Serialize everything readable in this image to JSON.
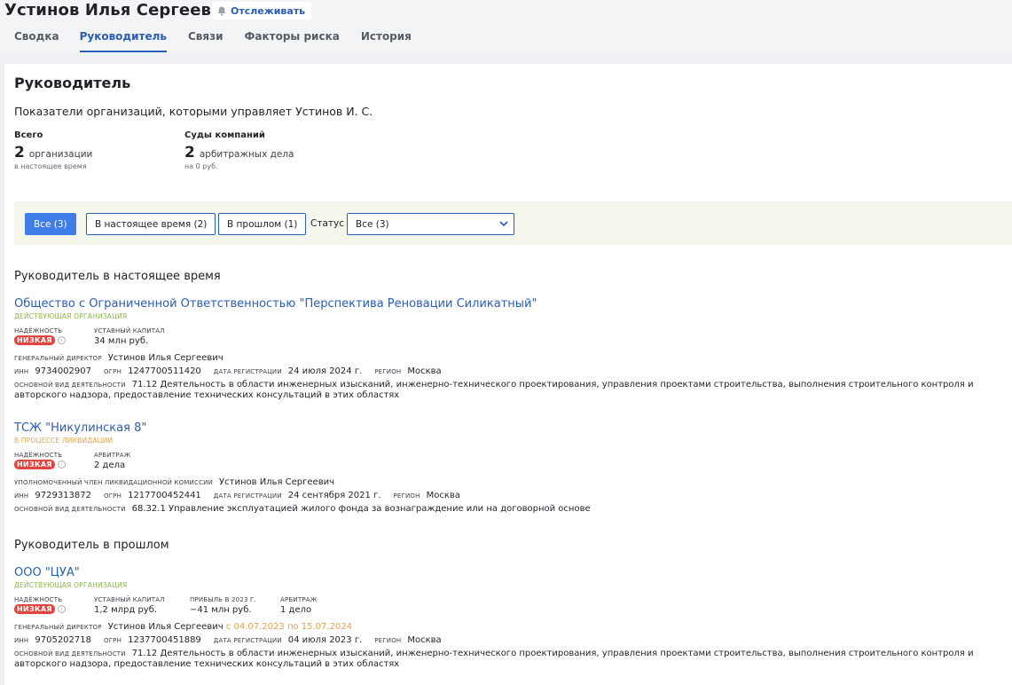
{
  "header": {
    "person_name": "Устинов Илья Сергеевич",
    "track_label": "Отслеживать",
    "tabs": [
      {
        "label": "Сводка"
      },
      {
        "label": "Руководитель"
      },
      {
        "label": "Связи"
      },
      {
        "label": "Факторы риска"
      },
      {
        "label": "История"
      }
    ]
  },
  "section": {
    "title": "Руководитель",
    "subtitle": "Показатели организаций, которыми управляет Устинов И. С.",
    "stats": [
      {
        "label": "Всего",
        "value": "2",
        "unit": "организации",
        "note": "в настоящее время"
      },
      {
        "label": "Суды компаний",
        "value": "2",
        "unit": "арбитражных дела",
        "note": "на 0 руб."
      }
    ]
  },
  "filters": {
    "all": "Все (3)",
    "current": "В настоящее время (2)",
    "past": "В прошлом (1)",
    "status_label": "Статус",
    "status_value": "Все (3)"
  },
  "groups": {
    "current_title": "Руководитель в настоящее время",
    "past_title": "Руководитель в прошлом"
  },
  "orgs": [
    {
      "name": "Общество с Ограниченной Ответственностью \"Перспектива Реновации Силикатный\"",
      "status": "ДЕЙСТВУЮЩАЯ ОРГАНИЗАЦИЯ",
      "reliability_label": "НАДЁЖНОСТЬ",
      "reliability": "НИЗКАЯ",
      "m2_label": "УСТАВНЫЙ КАПИТАЛ",
      "m2_value": "34 млн руб.",
      "role_label": "ГЕНЕРАЛЬНЫЙ ДИРЕКТОР",
      "role_value": "Устинов Илья Сергеевич",
      "inn_label": "ИНН",
      "inn": "9734002907",
      "ogrn_label": "ОГРН",
      "ogrn": "1247700511420",
      "reg_label": "ДАТА РЕГИСТРАЦИИ",
      "reg": "24 июля 2024 г.",
      "region_label": "РЕГИОН",
      "region": "Москва",
      "activity_label": "ОСНОВНОЙ ВИД ДЕЯТЕЛЬНОСТИ",
      "activity": "71.12 Деятельность в области инженерных изысканий, инженерно-технического проектирования, управления проектами строительства, выполнения строительного контроля и авторского надзора, предоставление технических консультаций в этих областях"
    },
    {
      "name": "ТСЖ \"Никулинская 8\"",
      "status": "В ПРОЦЕССЕ ЛИКВИДАЦИИ",
      "reliability_label": "НАДЁЖНОСТЬ",
      "reliability": "НИЗКАЯ",
      "m2_label": "АРБИТРАЖ",
      "m2_value": "2 дела",
      "role_label": "УПОЛНОМОЧЕННЫЙ ЧЛЕН ЛИКВИДАЦИОННОЙ КОМИССИИ",
      "role_value": "Устинов Илья Сергеевич",
      "inn_label": "ИНН",
      "inn": "9729313872",
      "ogrn_label": "ОГРН",
      "ogrn": "1217700452441",
      "reg_label": "ДАТА РЕГИСТРАЦИИ",
      "reg": "24 сентября 2021 г.",
      "region_label": "РЕГИОН",
      "region": "Москва",
      "activity_label": "ОСНОВНОЙ ВИД ДЕЯТЕЛЬНОСТИ",
      "activity": "68.32.1 Управление эксплуатацией жилого фонда за вознаграждение или на договорной основе"
    },
    {
      "name": "ООО \"ЦУА\"",
      "status": "ДЕЙСТВУЮЩАЯ ОРГАНИЗАЦИЯ",
      "reliability_label": "НАДЁЖНОСТЬ",
      "reliability": "НИЗКАЯ",
      "m2_label": "УСТАВНЫЙ КАПИТАЛ",
      "m2_value": "1,2 млрд руб.",
      "m3_label": "ПРИБЫЛЬ В 2023 Г.",
      "m3_value": "−41 млн руб.",
      "m4_label": "АРБИТРАЖ",
      "m4_value": "1 дело",
      "role_label": "ГЕНЕРАЛЬНЫЙ ДИРЕКТОР",
      "role_value": "Устинов Илья Сергеевич",
      "role_period": "с 04.07.2023 по 15.07.2024",
      "inn_label": "ИНН",
      "inn": "9705202718",
      "ogrn_label": "ОГРН",
      "ogrn": "1237700451889",
      "reg_label": "ДАТА РЕГИСТРАЦИИ",
      "reg": "04 июля 2023 г.",
      "region_label": "РЕГИОН",
      "region": "Москва",
      "activity_label": "ОСНОВНОЙ ВИД ДЕЯТЕЛЬНОСТИ",
      "activity": "71.12 Деятельность в области инженерных изысканий, инженерно-технического проектирования, управления проектами строительства, выполнения строительного контроля и авторского надзора, предоставление технических консультаций в этих областях"
    }
  ]
}
